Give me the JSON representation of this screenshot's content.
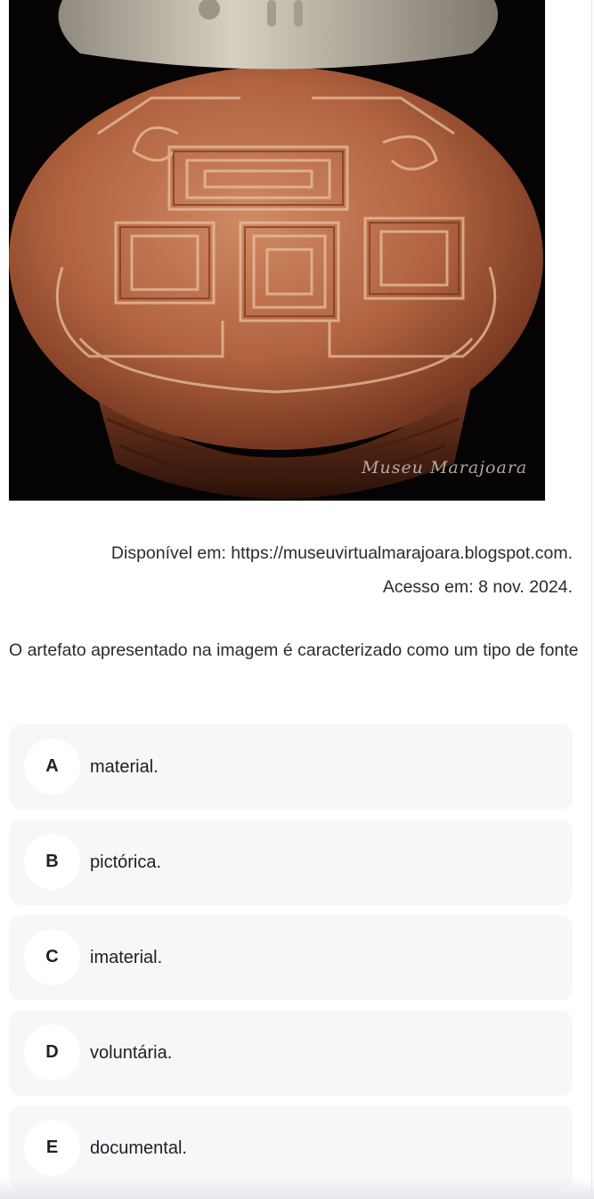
{
  "image": {
    "watermark": "Museu Marajoara"
  },
  "caption": {
    "source": "Disponível em: https://museuvirtualmarajoara.blogspot.com.",
    "access": "Acesso em: 8 nov. 2024."
  },
  "question": {
    "text": "O artefato apresentado na imagem é caracterizado como um tipo de fonte"
  },
  "options": [
    {
      "letter": "A",
      "text": "material."
    },
    {
      "letter": "B",
      "text": "pictórica."
    },
    {
      "letter": "C",
      "text": "imaterial."
    },
    {
      "letter": "D",
      "text": "voluntária."
    },
    {
      "letter": "E",
      "text": "documental."
    }
  ],
  "colors": {
    "option_background": "#f6f7f9",
    "letter_circle": "#ffffff",
    "vase_body": "#b86a47",
    "vase_neck": "#c9c2b3",
    "image_background": "#050303"
  }
}
